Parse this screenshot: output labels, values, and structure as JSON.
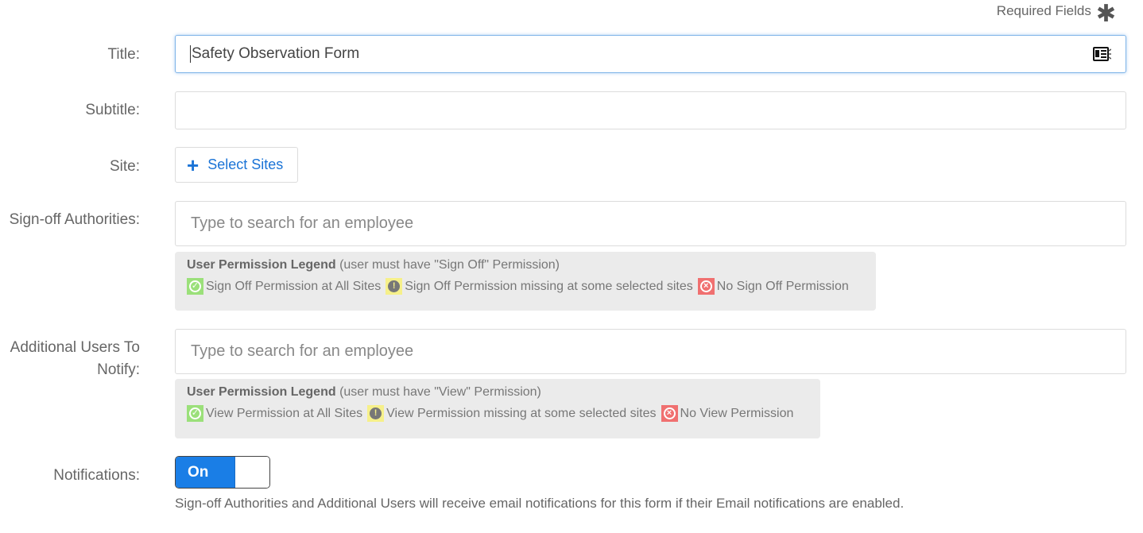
{
  "required_note": {
    "label": "Required Fields",
    "icon": "asterisk-icon"
  },
  "fields": {
    "title": {
      "label": "Title:",
      "value": "Safety Observation Form",
      "icon": "contact-card-icon"
    },
    "subtitle": {
      "label": "Subtitle:",
      "value": ""
    },
    "site": {
      "label": "Site:",
      "button_label": "Select Sites",
      "button_icon": "plus-icon"
    },
    "signoff": {
      "label": "Sign-off Authorities:",
      "placeholder": "Type to search for an employee",
      "legend": {
        "title_bold": "User Permission Legend",
        "title_rest": " (user must have \"Sign Off\" Permission)",
        "items": [
          {
            "status": "green",
            "icon": "check-icon",
            "text": "Sign Off Permission at All Sites"
          },
          {
            "status": "yellow",
            "icon": "exclamation-icon",
            "text": "Sign Off Permission missing at some selected sites"
          },
          {
            "status": "red",
            "icon": "x-icon",
            "text": "No Sign Off Permission"
          }
        ]
      }
    },
    "additional": {
      "label_line1": "Additional Users To",
      "label_line2": "Notify:",
      "placeholder": "Type to search for an employee",
      "legend": {
        "title_bold": "User Permission Legend",
        "title_rest": " (user must have \"View\" Permission)",
        "items": [
          {
            "status": "green",
            "icon": "check-icon",
            "text": "View Permission at All Sites"
          },
          {
            "status": "yellow",
            "icon": "exclamation-icon",
            "text": "View Permission missing at some selected sites"
          },
          {
            "status": "red",
            "icon": "x-icon",
            "text": "No View Permission"
          }
        ]
      }
    },
    "notifications": {
      "label": "Notifications:",
      "toggle_label": "On",
      "help": "Sign-off Authorities and Additional Users will receive email notifications for this form if their Email notifications are enabled."
    }
  },
  "colors": {
    "accent": "#1a7ee6",
    "link": "#1a73d6",
    "legend_bg": "#ebebeb",
    "ok": "#9be07a",
    "warn": "#f6f08a",
    "error": "#f07070"
  }
}
